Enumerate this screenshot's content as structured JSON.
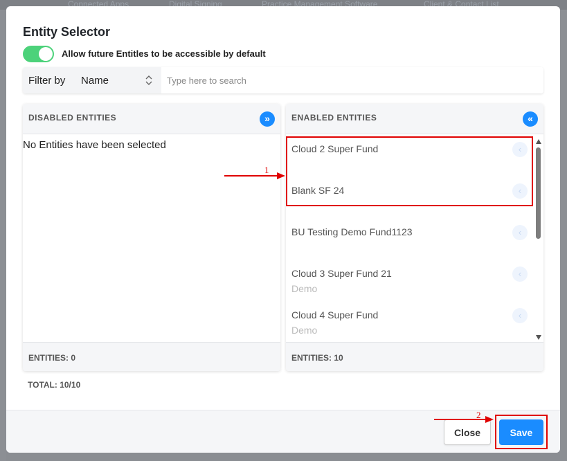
{
  "background": {
    "tabs": [
      "Connected Apps",
      "Digital Signing",
      "Practice Management Software",
      "Client & Contact List"
    ]
  },
  "dialog": {
    "title": "Entity Selector",
    "toggle": {
      "label": "Allow future Entitles to be accessible by default",
      "on": true
    },
    "filter": {
      "label": "Filter by",
      "selected": "Name",
      "search_placeholder": "Type here to search",
      "search_value": ""
    },
    "disabled_panel": {
      "header": "DISABLED ENTITIES",
      "move_all_icon": "double-chevron-right-icon",
      "move_all_glyph": "»",
      "empty_text": "No Entities have been selected",
      "footer": "ENTITIES: 0"
    },
    "enabled_panel": {
      "header": "ENABLED ENTITIES",
      "move_all_icon": "double-chevron-left-icon",
      "move_all_glyph": "«",
      "item_glyph": "‹",
      "items": [
        {
          "name": "Cloud 2 Super Fund",
          "sub": ""
        },
        {
          "name": "Blank SF 24",
          "sub": ""
        },
        {
          "name": "BU Testing Demo Fund1123",
          "sub": ""
        },
        {
          "name": "Cloud 3 Super Fund 21",
          "sub": "Demo"
        },
        {
          "name": "Cloud 4 Super Fund",
          "sub": "Demo"
        }
      ],
      "footer": "ENTITIES: 10"
    },
    "total": "TOTAL: 10/10",
    "buttons": {
      "close": "Close",
      "save": "Save"
    }
  },
  "annotations": {
    "marker_1": "1",
    "marker_2": "2",
    "color": "#e00000"
  },
  "colors": {
    "accent": "#1a8cff",
    "toggle_on": "#4cd27a"
  }
}
